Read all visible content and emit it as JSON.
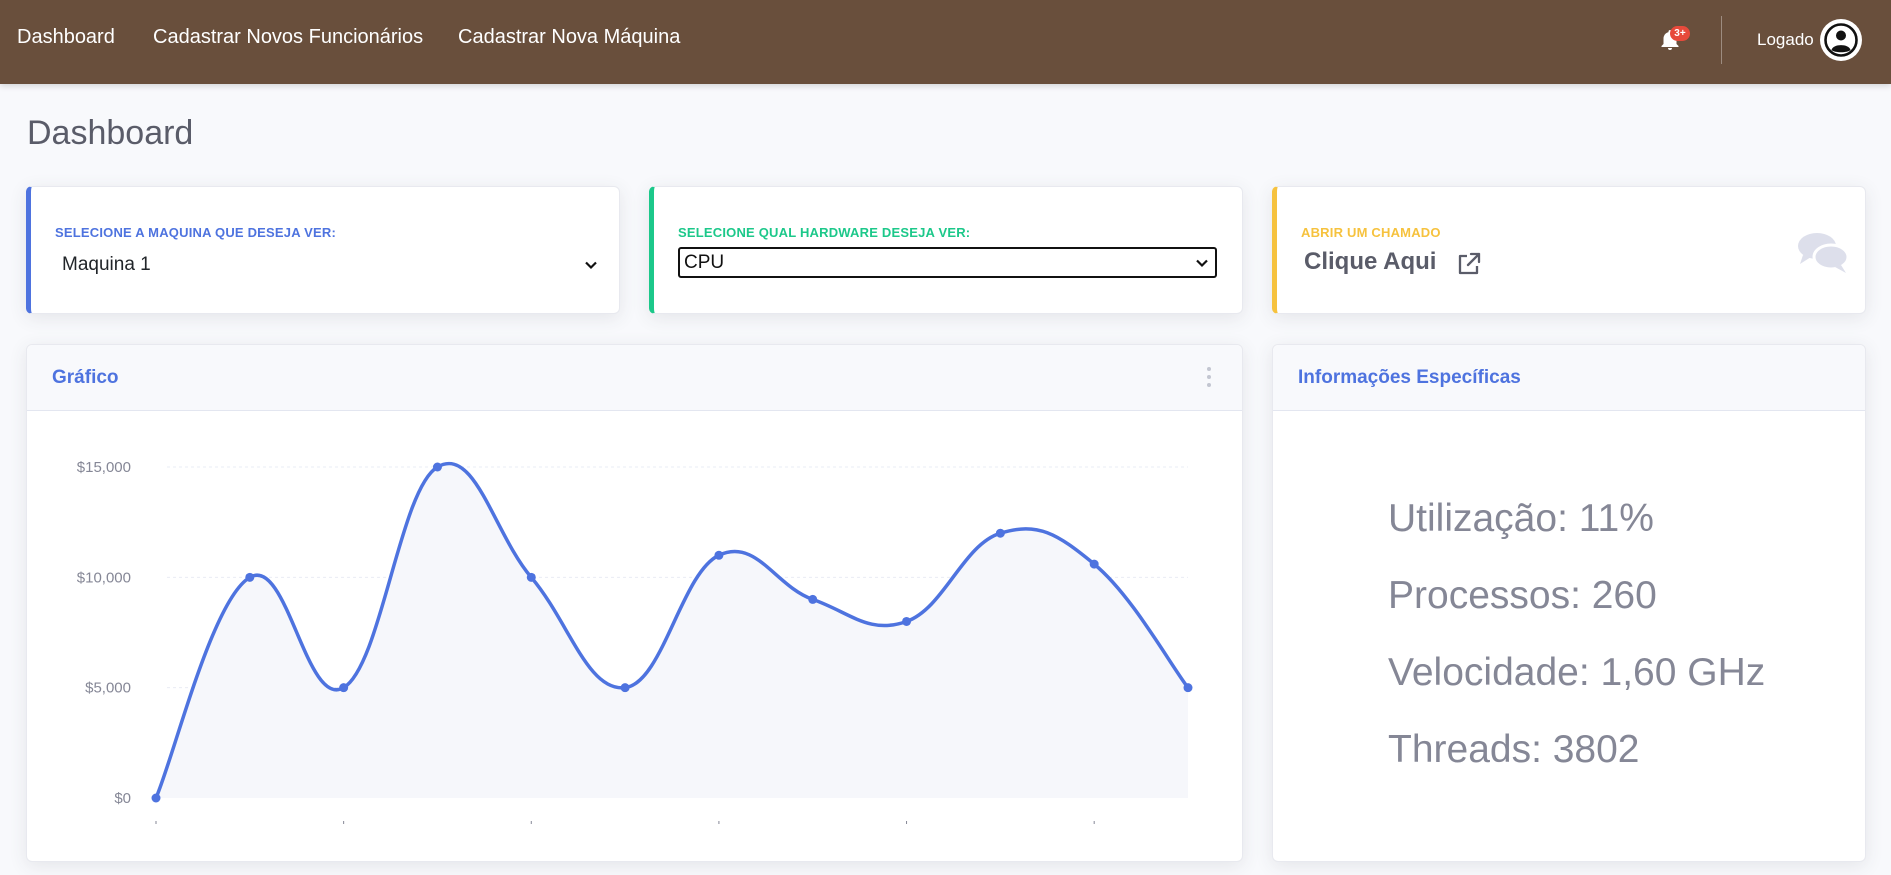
{
  "nav": {
    "links": [
      "Dashboard",
      "Cadastrar Novos Funcionários",
      "Cadastrar Nova Máquina"
    ],
    "alerts_badge": "3+",
    "user_label": "Logado"
  },
  "page_title": "Dashboard",
  "cards": {
    "machine": {
      "label": "SELECIONE A MAQUINA QUE DESEJA VER:",
      "selected": "Maquina 1",
      "accent": "#4e73df"
    },
    "hardware": {
      "label": "SELECIONE QUAL HARDWARE DESEJA VER:",
      "selected": "CPU",
      "accent": "#1cc88a"
    },
    "ticket": {
      "label": "ABRIR UM CHAMADO",
      "link_text": "Clique Aqui",
      "accent": "#f6c23e",
      "icon": "comments-icon"
    }
  },
  "chart_card": {
    "title": "Gráfico"
  },
  "info_card": {
    "title": "Informações Específicas",
    "lines": [
      "Utilização: 11%",
      "Processos: 260",
      "Velocidade: 1,60 GHz",
      "Threads: 3802"
    ]
  },
  "chart_data": {
    "type": "area",
    "title": "",
    "xlabel": "",
    "ylabel": "",
    "x": [
      0,
      1,
      2,
      3,
      4,
      5,
      6,
      7,
      8,
      9,
      10,
      11
    ],
    "series": [
      {
        "values": [
          0,
          10000,
          5000,
          15000,
          10000,
          5000,
          11000,
          9000,
          8000,
          12000,
          10600,
          5000
        ]
      }
    ],
    "ylim": [
      0,
      15000
    ],
    "yticks": [
      "$0",
      "$5,000",
      "$10,000",
      "$15,000"
    ],
    "ytick_values": [
      0,
      5000,
      10000,
      15000
    ],
    "grid": true,
    "legend": "none",
    "line_color": "#4e73df",
    "fill_color": "#f6f7fb"
  }
}
